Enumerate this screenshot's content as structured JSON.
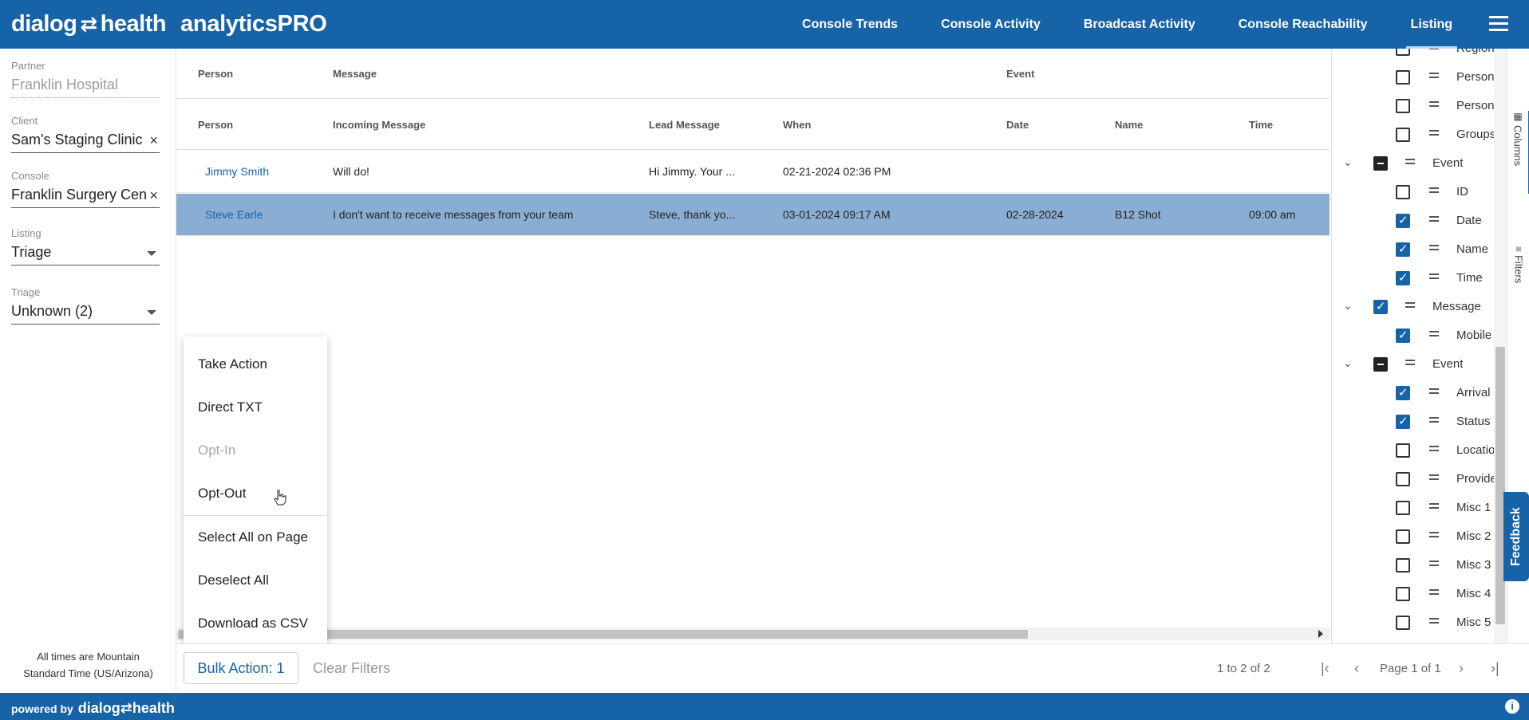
{
  "header": {
    "brand_left": "dialog",
    "brand_right": "health",
    "product": "analyticsPRO",
    "nav": [
      "Console Trends",
      "Console Activity",
      "Broadcast Activity",
      "Console Reachability",
      "Listing"
    ],
    "active_nav": "Listing"
  },
  "filters": {
    "partner_label": "Partner",
    "partner_value": "Franklin Hospital",
    "client_label": "Client",
    "client_value": "Sam's Staging Clinic",
    "console_label": "Console",
    "console_value": "Franklin Surgery Cen",
    "listing_label": "Listing",
    "listing_value": "Triage",
    "triage_label": "Triage",
    "triage_value": "Unknown (2)",
    "clear_glyph": "×",
    "timezone_note_1": "All times are Mountain",
    "timezone_note_2": "Standard Time (US/Arizona)"
  },
  "grid": {
    "group_headers": {
      "person": "Person",
      "message": "Message",
      "event": "Event"
    },
    "columns": {
      "person": "Person",
      "incoming": "Incoming Message",
      "lead": "Lead Message",
      "when": "When",
      "date": "Date",
      "name": "Name",
      "time": "Time"
    },
    "rows": [
      {
        "person": "Jimmy Smith",
        "incoming": "Will do!",
        "lead": "Hi Jimmy. Your ...",
        "when": "02-21-2024 02:36 PM",
        "date": "",
        "name": "",
        "time": ""
      },
      {
        "person": "Steve Earle",
        "incoming": "I don't want to receive messages from your team",
        "lead": "Steve, thank yo...",
        "when": "03-01-2024 09:17 AM",
        "date": "02-28-2024",
        "name": "B12 Shot",
        "time": "09:00 am"
      }
    ]
  },
  "menu": {
    "items": [
      "Take Action",
      "Direct TXT",
      "Opt-In",
      "Opt-Out",
      "Select All on Page",
      "Deselect All",
      "Download as CSV"
    ]
  },
  "footer": {
    "bulk_action": "Bulk Action: 1",
    "clear_filters": "Clear Filters",
    "range": "1 to 2 of 2",
    "page": "Page 1 of 1",
    "first_glyph": "|‹",
    "prev_glyph": "‹",
    "next_glyph": "›",
    "last_glyph": "›|"
  },
  "columns_panel": {
    "items": [
      "Region",
      "Person",
      "Person",
      "Groups",
      "Event",
      "ID",
      "Date",
      "Name",
      "Time",
      "Message",
      "Mobile",
      "Event",
      "Arrival",
      "Status",
      "Locatio",
      "Provide",
      "Misc 1",
      "Misc 2",
      "Misc 3",
      "Misc 4",
      "Misc 5"
    ]
  },
  "side_tabs": {
    "columns": "Columns",
    "filters": "Filters",
    "feedback": "Feedback"
  },
  "bottom": {
    "powered_by": "powered by",
    "brand": "dialog⇄health",
    "info": "i"
  }
}
